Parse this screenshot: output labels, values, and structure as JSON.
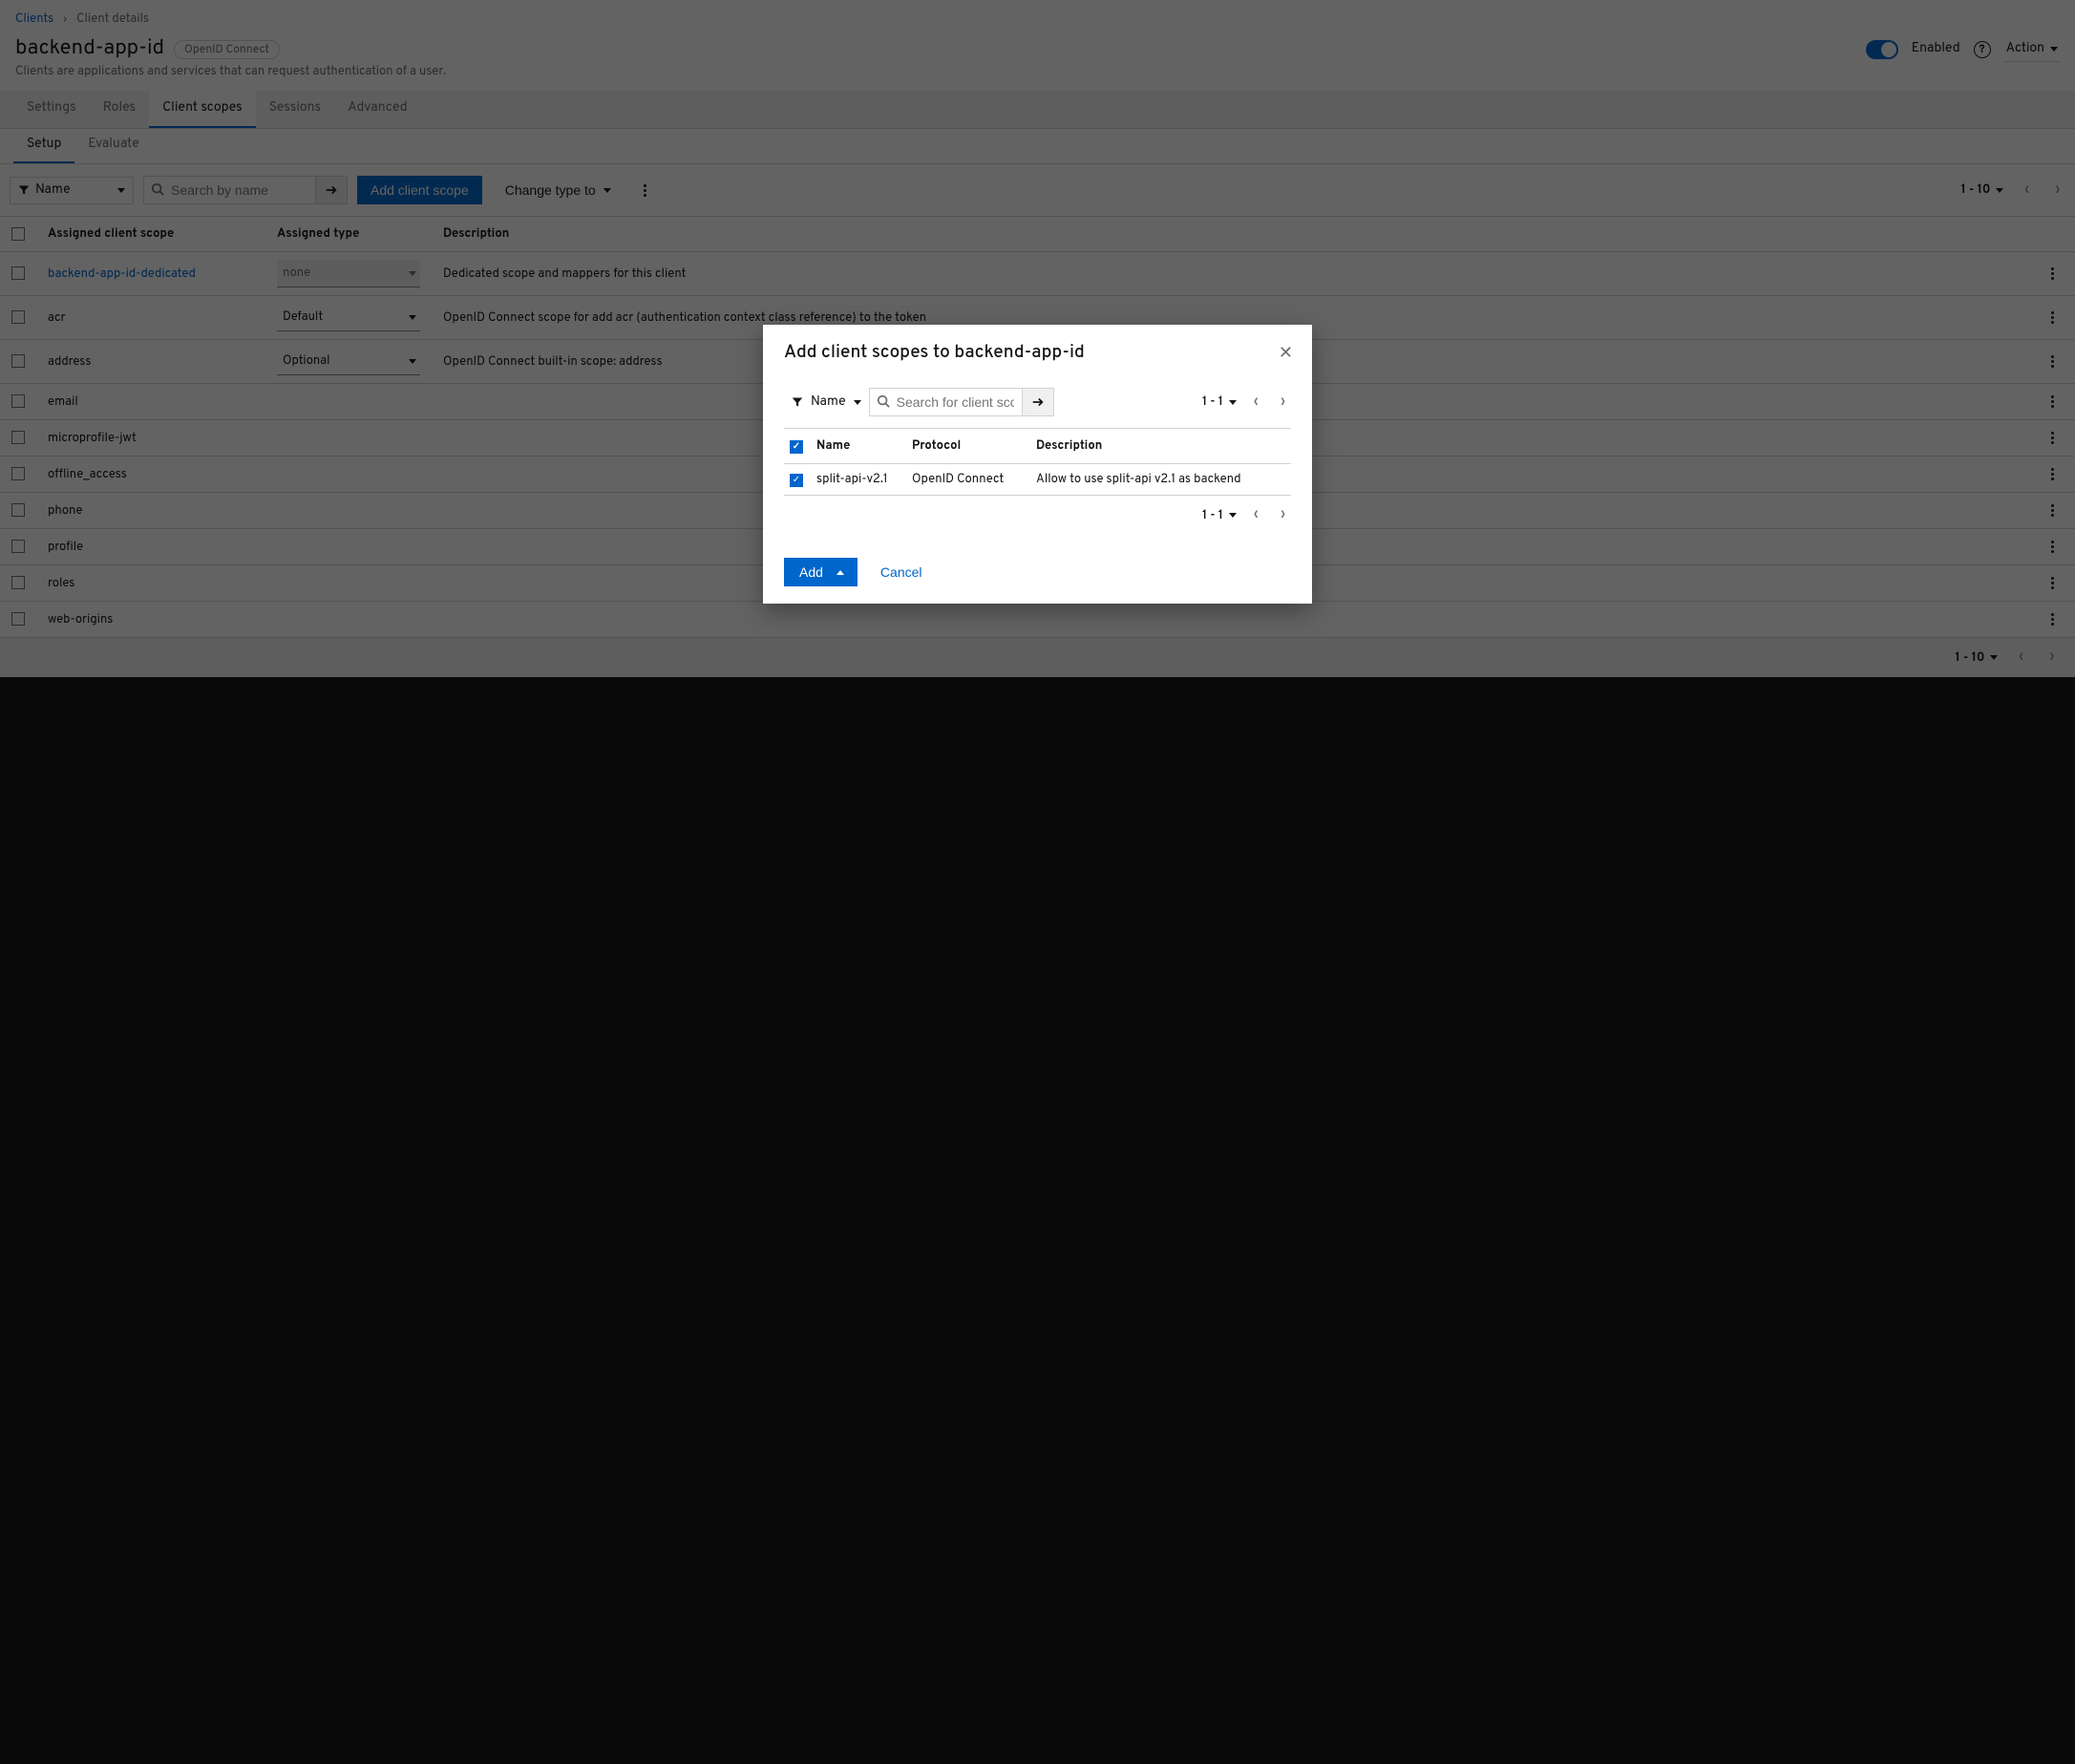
{
  "breadcrumb": {
    "parent": "Clients",
    "current": "Client details"
  },
  "header": {
    "title": "backend-app-id",
    "badge": "OpenID Connect",
    "description": "Clients are applications and services that can request authentication of a user.",
    "enabled_label": "Enabled",
    "action_label": "Action"
  },
  "tabs": {
    "items": [
      "Settings",
      "Roles",
      "Client scopes",
      "Sessions",
      "Advanced"
    ],
    "active_index": 2
  },
  "subtabs": {
    "items": [
      "Setup",
      "Evaluate"
    ],
    "active_index": 0
  },
  "toolbar": {
    "filter_field": "Name",
    "search_placeholder": "Search by name",
    "add_button": "Add client scope",
    "change_type": "Change type to",
    "pagination": "1 - 10"
  },
  "table": {
    "columns": {
      "name": "Assigned client scope",
      "type": "Assigned type",
      "description": "Description"
    },
    "rows": [
      {
        "name": "backend-app-id-dedicated",
        "name_link": true,
        "type": "none",
        "type_disabled": true,
        "description": "Dedicated scope and mappers for this client"
      },
      {
        "name": "acr",
        "type": "Default",
        "description": "OpenID Connect scope for add acr (authentication context class reference) to the token"
      },
      {
        "name": "address",
        "type": "Optional",
        "description": "OpenID Connect built-in scope: address"
      },
      {
        "name": "email",
        "type": "",
        "description": ""
      },
      {
        "name": "microprofile-jwt",
        "type": "",
        "description": ""
      },
      {
        "name": "offline_access",
        "type": "",
        "description": ""
      },
      {
        "name": "phone",
        "type": "",
        "description": ""
      },
      {
        "name": "profile",
        "type": "",
        "description": ""
      },
      {
        "name": "roles",
        "type": "",
        "description": ""
      },
      {
        "name": "web-origins",
        "type": "",
        "description": ""
      }
    ]
  },
  "footer": {
    "pagination": "1 - 10"
  },
  "modal": {
    "title": "Add client scopes to backend-app-id",
    "filter_field": "Name",
    "search_placeholder": "Search for client scope",
    "pagination": "1 - 1",
    "columns": {
      "name": "Name",
      "protocol": "Protocol",
      "description": "Description"
    },
    "rows": [
      {
        "name": "split-api-v2.1",
        "protocol": "OpenID Connect",
        "description": "Allow to use split-api v2.1 as backend",
        "checked": true
      }
    ],
    "add_label": "Add",
    "cancel_label": "Cancel"
  }
}
